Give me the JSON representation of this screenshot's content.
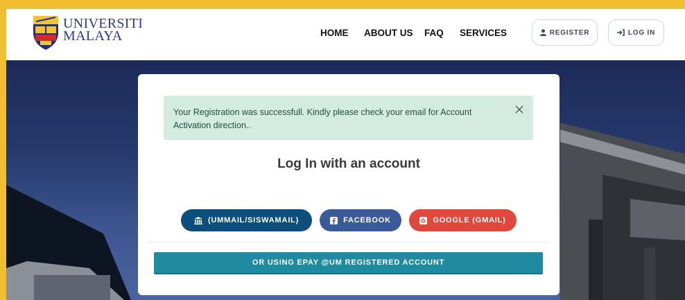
{
  "brand": {
    "line1": "UNIVERSITI",
    "line2": "MALAYA"
  },
  "nav": {
    "home": "HOME",
    "about": "ABOUT US",
    "faq": "FAQ",
    "services": "SERVICES"
  },
  "header_buttons": {
    "register": "REGISTER",
    "login": "LOG IN"
  },
  "alert": {
    "message": "Your Registration was successfull. Kindly please check your email for Account Activation direction.."
  },
  "login": {
    "title": "Log In with an account",
    "um_button": "(UMMAIL/SISWAMAIL)",
    "facebook_button": "FACEBOOK",
    "google_button": "GOOGLE (GMAIL)",
    "epay_button": "OR USING EPAY @UM REGISTERED ACCOUNT"
  },
  "colors": {
    "frame": "#f0be2e",
    "um_button": "#0d4f7c",
    "facebook_button": "#3b5a9a",
    "google_button": "#e2473b",
    "epay_button": "#1f8aa0",
    "alert_bg": "#d3ebe1"
  },
  "icons": {
    "um": "institution-icon",
    "facebook": "facebook-icon",
    "google": "google-icon",
    "register": "user-icon",
    "login": "sign-in-icon",
    "close": "close-icon"
  }
}
